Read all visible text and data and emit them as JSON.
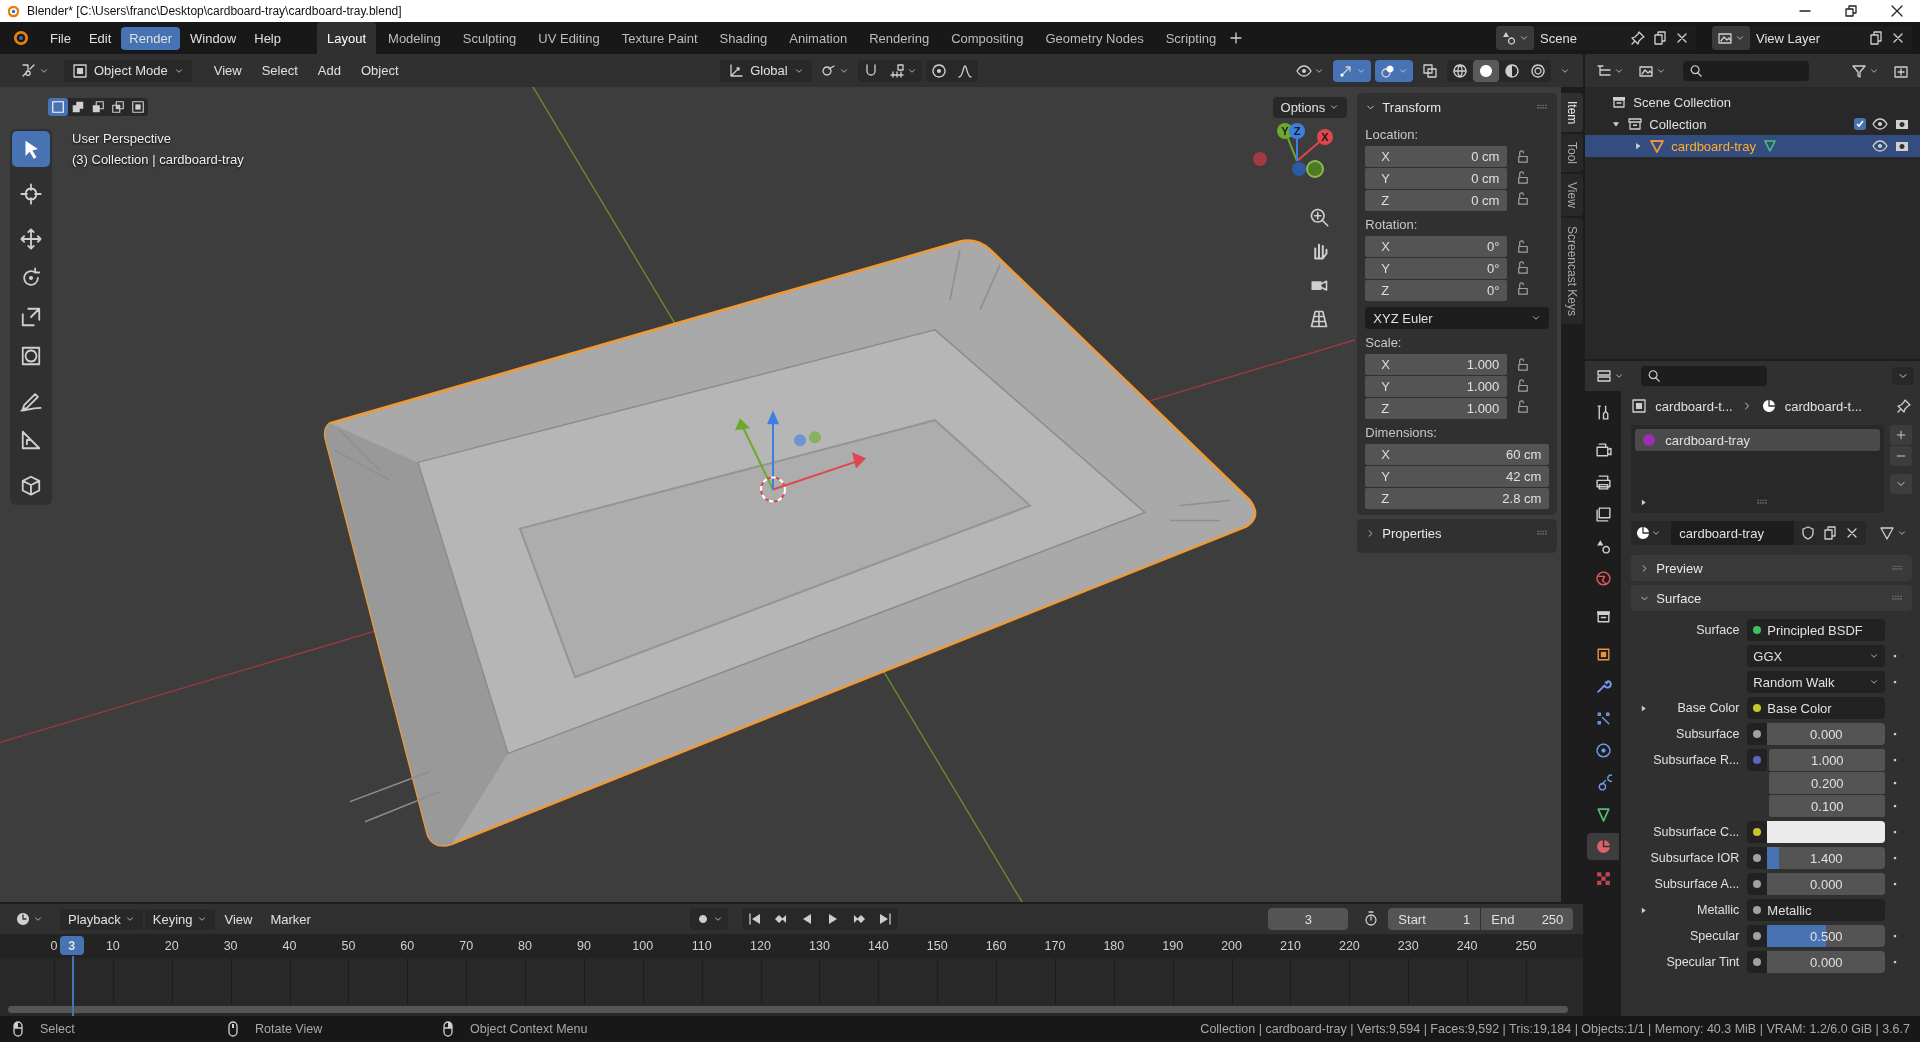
{
  "window": {
    "title": "Blender* [C:\\Users\\franc\\Desktop\\cardboard-tray\\cardboard-tray.blend]"
  },
  "menus": [
    {
      "label": "File",
      "selected": false
    },
    {
      "label": "Edit",
      "selected": false
    },
    {
      "label": "Render",
      "selected": true
    },
    {
      "label": "Window",
      "selected": false
    },
    {
      "label": "Help",
      "selected": false
    }
  ],
  "workspaces": [
    {
      "label": "Layout",
      "selected": true
    },
    {
      "label": "Modeling",
      "selected": false
    },
    {
      "label": "Sculpting",
      "selected": false
    },
    {
      "label": "UV Editing",
      "selected": false
    },
    {
      "label": "Texture Paint",
      "selected": false
    },
    {
      "label": "Shading",
      "selected": false
    },
    {
      "label": "Animation",
      "selected": false
    },
    {
      "label": "Rendering",
      "selected": false
    },
    {
      "label": "Compositing",
      "selected": false
    },
    {
      "label": "Geometry Nodes",
      "selected": false
    },
    {
      "label": "Scripting",
      "selected": false
    }
  ],
  "scene": "Scene",
  "view_layer": "View Layer",
  "viewport": {
    "mode": "Object Mode",
    "menus": [
      "View",
      "Select",
      "Add",
      "Object"
    ],
    "orientation": "Global",
    "options": "Options",
    "selection_modes": [
      {
        "kind": "set",
        "selected": true
      },
      {
        "kind": "extend",
        "selected": false
      },
      {
        "kind": "subtract",
        "selected": false
      },
      {
        "kind": "invert",
        "selected": false
      },
      {
        "kind": "intersect",
        "selected": false
      }
    ],
    "toggles": [
      {
        "kind": "gizmo",
        "on": true
      },
      {
        "kind": "overlay",
        "on": true
      },
      {
        "kind": "xray",
        "on": false
      }
    ],
    "shading": [
      {
        "kind": "wireframe",
        "selected": false
      },
      {
        "kind": "solid",
        "selected": true
      },
      {
        "kind": "material",
        "selected": false
      },
      {
        "kind": "rendered",
        "selected": false
      }
    ],
    "view_name": "User Perspective",
    "object_info": "(3) Collection | cardboard-tray",
    "axis_labels": [
      "X",
      "Y",
      "Z"
    ],
    "tools": [
      {
        "kind": "select_box",
        "selected": true
      },
      {
        "kind": "cursor",
        "selected": false
      },
      {
        "kind": "move",
        "selected": false
      },
      {
        "kind": "rotate",
        "selected": false
      },
      {
        "kind": "scale",
        "selected": false
      },
      {
        "kind": "transform",
        "selected": false
      },
      {
        "kind": "annotate",
        "selected": false
      },
      {
        "kind": "measure",
        "selected": false
      },
      {
        "kind": "add_cube",
        "selected": false
      }
    ]
  },
  "sidebar": {
    "tabs": [
      {
        "label": "Item",
        "selected": true
      },
      {
        "label": "Tool",
        "selected": false
      },
      {
        "label": "View",
        "selected": false
      },
      {
        "label": "Screencast Keys",
        "selected": false
      }
    ],
    "transform": {
      "title": "Transform",
      "expanded": true,
      "groups": [
        {
          "label": "Location:",
          "lockable": true,
          "rows": [
            {
              "axis": "X",
              "value": "0 cm"
            },
            {
              "axis": "Y",
              "value": "0 cm"
            },
            {
              "axis": "Z",
              "value": "0 cm"
            }
          ]
        },
        {
          "label": "Rotation:",
          "lockable": true,
          "rows": [
            {
              "axis": "X",
              "value": "0°"
            },
            {
              "axis": "Y",
              "value": "0°"
            },
            {
              "axis": "Z",
              "value": "0°"
            }
          ],
          "mode": "XYZ Euler"
        },
        {
          "label": "Scale:",
          "lockable": true,
          "rows": [
            {
              "axis": "X",
              "value": "1.000"
            },
            {
              "axis": "Y",
              "value": "1.000"
            },
            {
              "axis": "Z",
              "value": "1.000"
            }
          ]
        },
        {
          "label": "Dimensions:",
          "lockable": false,
          "rows": [
            {
              "axis": "X",
              "value": "60 cm"
            },
            {
              "axis": "Y",
              "value": "42 cm"
            },
            {
              "axis": "Z",
              "value": "2.8 cm"
            }
          ]
        }
      ]
    },
    "properties": {
      "title": "Properties",
      "expanded": false
    }
  },
  "outliner": {
    "tree": [
      {
        "label": "Scene Collection",
        "kind": "scene_collection",
        "selected": false,
        "children": [
          {
            "label": "Collection",
            "kind": "collection",
            "selected": false,
            "expanded": true,
            "checked": true,
            "children": [
              {
                "label": "cardboard-tray",
                "kind": "object",
                "selected": true,
                "expanded": false
              }
            ]
          }
        ]
      }
    ]
  },
  "properties": {
    "tabs": [
      {
        "kind": "tool",
        "selected": false
      },
      {
        "kind": "render",
        "selected": false
      },
      {
        "kind": "output",
        "selected": false
      },
      {
        "kind": "view_layer",
        "selected": false
      },
      {
        "kind": "scene",
        "selected": false
      },
      {
        "kind": "world",
        "selected": false
      },
      {
        "kind": "collection",
        "selected": false
      },
      {
        "kind": "object",
        "selected": false
      },
      {
        "kind": "modifiers",
        "selected": false
      },
      {
        "kind": "particles",
        "selected": false
      },
      {
        "kind": "physics",
        "selected": false
      },
      {
        "kind": "constraints",
        "selected": false
      },
      {
        "kind": "data",
        "selected": false
      },
      {
        "kind": "material",
        "selected": true
      },
      {
        "kind": "texture",
        "selected": false
      }
    ],
    "breadcrumb": [
      "cardboard-t...",
      "cardboard-t..."
    ],
    "slots": [
      {
        "name": "cardboard-tray",
        "selected": true
      }
    ],
    "material": "cardboard-tray",
    "panels": [
      {
        "title": "Preview",
        "expanded": false
      },
      {
        "title": "Surface",
        "expanded": true
      }
    ],
    "rows": [
      {
        "kind": "link",
        "label": "Surface",
        "value": "Principled BSDF",
        "color": "#3fc15a"
      },
      {
        "kind": "dropdown",
        "value": "GGX"
      },
      {
        "kind": "dropdown",
        "value": "Random Walk"
      },
      {
        "kind": "link",
        "label": "Base Color",
        "value": "Base Color",
        "color": "#c7c729",
        "expandable": true
      },
      {
        "kind": "number",
        "label": "Subsurface",
        "value": "0.000",
        "color": "#a1a1a1"
      },
      {
        "kind": "vector",
        "label": "Subsurface R...",
        "values": [
          "1.000",
          "0.200",
          "0.100"
        ],
        "color": "#6363c7"
      },
      {
        "kind": "color",
        "label": "Subsurface C...",
        "swatch": {
          "color": "#ebebeb"
        },
        "color": "#c7c729"
      },
      {
        "kind": "number",
        "label": "Subsurface IOR",
        "value": "1.400",
        "level": 0.1,
        "color": "#a1a1a1"
      },
      {
        "kind": "number",
        "label": "Subsurface A...",
        "value": "0.000",
        "color": "#a1a1a1"
      },
      {
        "kind": "link",
        "label": "Metallic",
        "value": "Metallic",
        "color": "#a1a1a1",
        "expandable": true
      },
      {
        "kind": "number",
        "label": "Specular",
        "value": "0.500",
        "level": 0.5,
        "color": "#a1a1a1"
      },
      {
        "kind": "number",
        "label": "Specular Tint",
        "value": "0.000",
        "color": "#a1a1a1"
      }
    ]
  },
  "timeline": {
    "menus": [
      "Playback",
      "Keying",
      "View",
      "Marker"
    ],
    "current_frame": "3",
    "playhead": "3",
    "start_label": "Start",
    "start": "1",
    "end_label": "End",
    "end": "250",
    "ticks": [
      "0",
      "10",
      "20",
      "30",
      "40",
      "50",
      "60",
      "70",
      "80",
      "90",
      "100",
      "110",
      "120",
      "130",
      "140",
      "150",
      "160",
      "170",
      "180",
      "190",
      "200",
      "210",
      "220",
      "230",
      "240",
      "250"
    ]
  },
  "status_bar": {
    "hints": [
      {
        "kind": "left",
        "label": "Select"
      },
      {
        "kind": "middle",
        "label": "Rotate View"
      },
      {
        "kind": "right",
        "label": "Object Context Menu"
      }
    ],
    "stats": "Collection | cardboard-tray | Verts:9,594 | Faces:9,592 | Tris:19,184 | Objects:1/1 | Memory: 40.3 MiB | VRAM: 1.2/6.0 GiB | 3.6.7"
  }
}
